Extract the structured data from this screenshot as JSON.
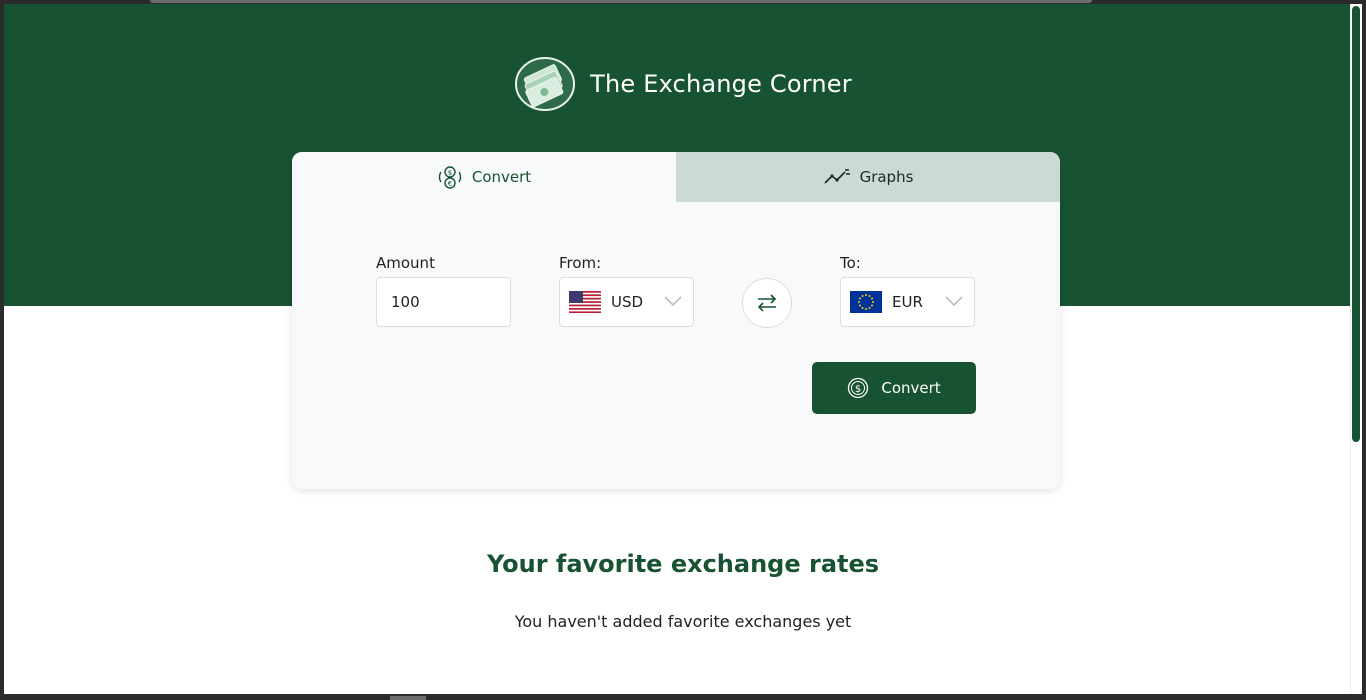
{
  "header": {
    "brand_title": "The Exchange Corner",
    "logo_icon": "money-bills-logo-icon"
  },
  "tabs": [
    {
      "label": "Convert",
      "icon": "currency-exchange-icon",
      "active": true
    },
    {
      "label": "Graphs",
      "icon": "line-graph-icon",
      "active": false
    }
  ],
  "converter": {
    "amount_label": "Amount",
    "amount_value": "100",
    "from_label": "From:",
    "from_currency": "USD",
    "from_flag": "us-flag-icon",
    "to_label": "To:",
    "to_currency": "EUR",
    "to_flag": "eu-flag-icon",
    "swap_icon": "swap-arrows-icon",
    "convert_label": "Convert",
    "convert_icon": "dollar-coin-icon"
  },
  "favorites": {
    "title": "Your favorite exchange rates",
    "empty_message": "You haven't added favorite exchanges yet"
  },
  "colors": {
    "brand_green": "#175332",
    "inactive_tab": "#cbdad3",
    "card_bg": "#f8f9fb"
  }
}
